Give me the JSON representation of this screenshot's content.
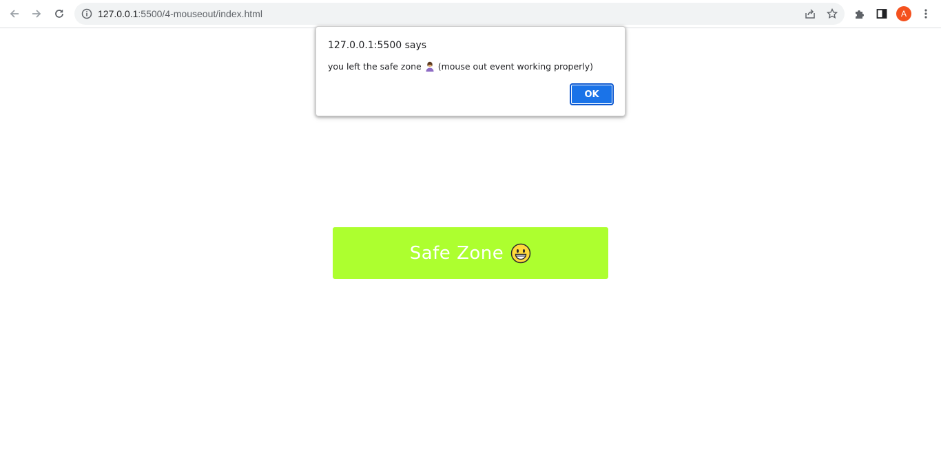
{
  "browser": {
    "url_host": "127.0.0.1",
    "url_path": ":5500/4-mouseout/index.html",
    "profile_initial": "A",
    "icons": {
      "back": "arrow-left-icon",
      "forward": "arrow-right-icon",
      "reload": "reload-icon",
      "site_info": "info-icon",
      "share": "share-icon",
      "bookmark": "star-icon",
      "extensions": "puzzle-icon",
      "side_panel": "side-panel-icon",
      "menu": "kebab-menu-icon"
    },
    "colors": {
      "avatar": "#f4511e",
      "omnibox": "#f1f3f4"
    }
  },
  "alert": {
    "title": "127.0.0.1:5500 says",
    "message_before": "you left the safe zone",
    "message_emoji": "person-icon",
    "message_after": "(mouse out event working properly)",
    "ok_label": "OK",
    "colors": {
      "ok_button": "#1a73e8"
    }
  },
  "safe_zone": {
    "label": "Safe Zone",
    "emoji": "grinning-face-icon",
    "colors": {
      "background": "#adff2f",
      "text": "#ffffff"
    }
  }
}
